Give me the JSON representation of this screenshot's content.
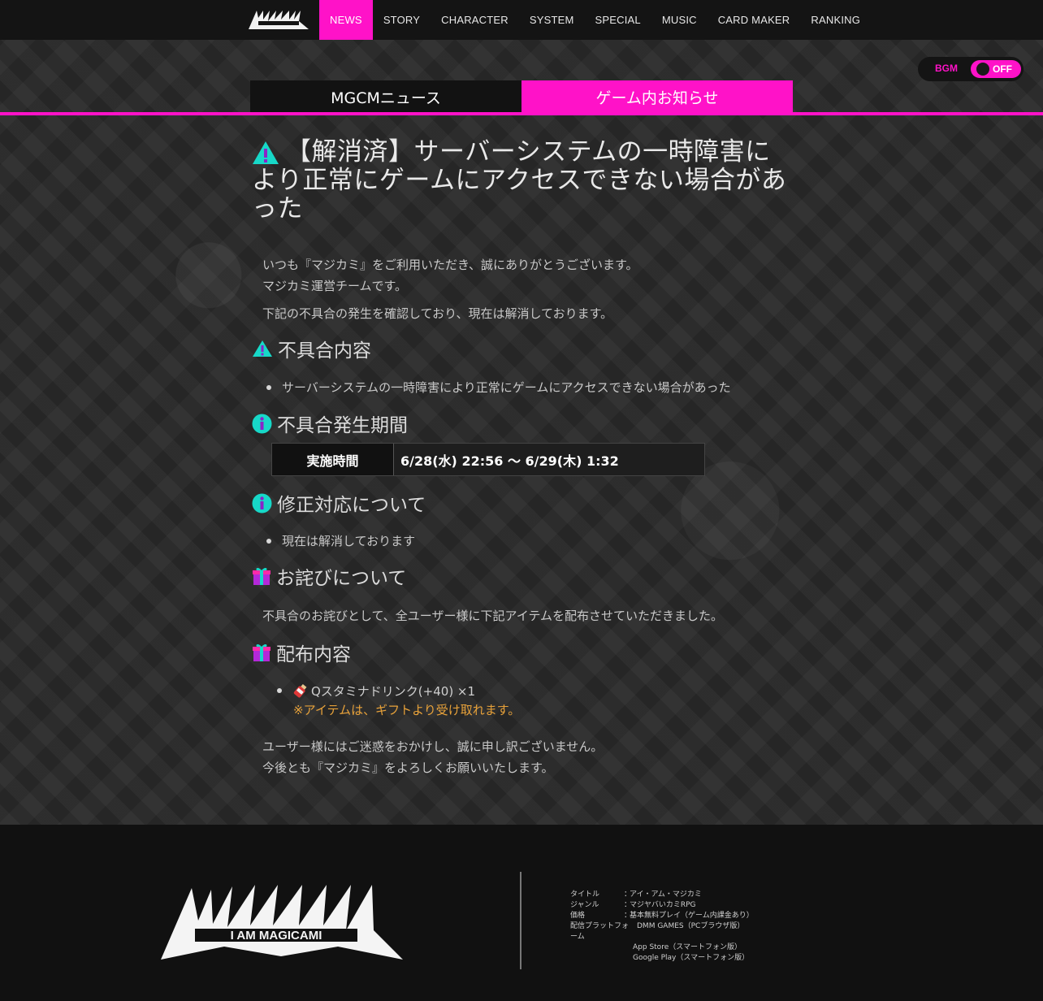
{
  "nav": {
    "logo_icon": "mgcm-logo-icon",
    "items": [
      "NEWS",
      "STORY",
      "CHARACTER",
      "SYSTEM",
      "SPECIAL",
      "MUSIC",
      "CARD MAKER",
      "RANKING"
    ],
    "active_index": 0,
    "accent": "#ff12c8"
  },
  "bgm": {
    "label": "BGM",
    "state": "OFF"
  },
  "tabs": {
    "news": "MGCMニュース",
    "ingame": "ゲーム内お知らせ",
    "active": "ingame"
  },
  "article": {
    "title": "【解消済】サーバーシステムの一時障害により正常にゲームにアクセスできない場合があった",
    "intro_line1": "いつも『マジカミ』をご利用いただき、誠にありがとうございます。",
    "intro_line2": "マジカミ運営チームです。",
    "intro_line3": "下記の不具合の発生を確認しており、現在は解消しております。",
    "sections": {
      "issue": {
        "icon": "warning-icon",
        "heading": "不具合内容",
        "bullets": [
          "サーバーシステムの一時障害により正常にゲームにアクセスできない場合があった"
        ]
      },
      "period": {
        "icon": "info-icon",
        "heading": "不具合発生期間",
        "table_label": "実施時間",
        "table_value": "6/28(水) 22:56 〜 6/29(木) 1:32"
      },
      "fix": {
        "icon": "info-icon",
        "heading": "修正対応について",
        "bullets": [
          "現在は解消しております"
        ]
      },
      "apology": {
        "icon": "gift-icon",
        "heading": "お詫びについて",
        "text": "不具合のお詫びとして、全ユーザー様に下記アイテムを配布させていただきました。"
      },
      "distribution": {
        "icon": "gift-icon",
        "heading": "配布内容",
        "item": "Qスタミナドリンク(+40) ×1",
        "item_icon": "stamina-drink-icon",
        "note": "※アイテムは、ギフトより受け取れます。"
      }
    },
    "closing_line1": "ユーザー様にはご迷惑をおかけし、誠に申し訳ございません。",
    "closing_line2": "今後とも『マジカミ』をよろしくお願いいたします。"
  },
  "footer": {
    "logo_text": "I AM MAGICAMI",
    "info": [
      {
        "key": "タイトル",
        "sep": "：",
        "value": "アイ・アム・マジカミ"
      },
      {
        "key": "ジャンル",
        "sep": "：",
        "value": "マジヤバいカミRPG"
      },
      {
        "key": "価格",
        "sep": "：",
        "value": "基本無料プレイ（ゲーム内課金あり）"
      },
      {
        "key": "配信プラットフォーム",
        "sep": "",
        "value": "DMM GAMES（PCブラウザ版）"
      },
      {
        "key": "",
        "sep": "",
        "value": "App Store（スマートフォン版）"
      },
      {
        "key": "",
        "sep": "",
        "value": "Google Play（スマートフォン版）"
      }
    ]
  }
}
